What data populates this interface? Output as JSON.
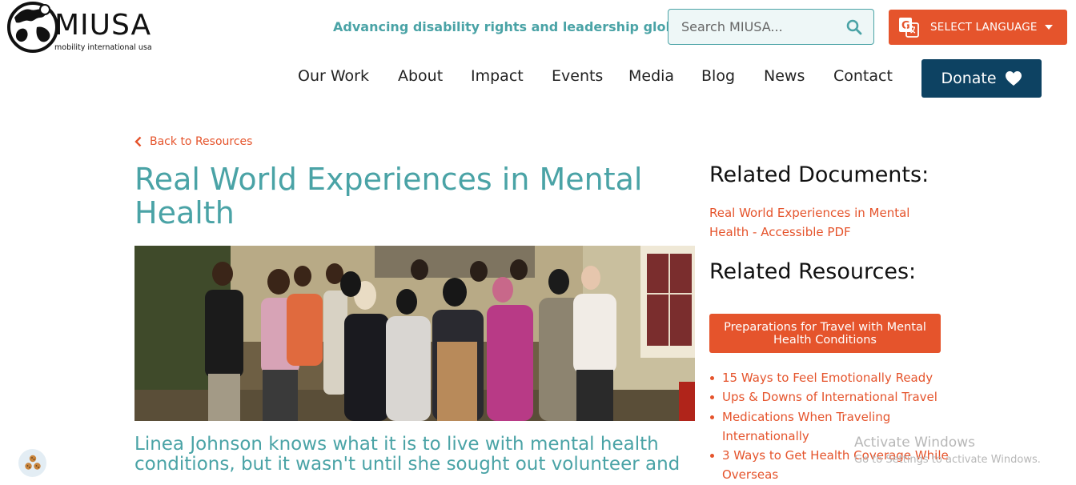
{
  "brand": {
    "name": "MIUSA",
    "subtitle": "mobility international usa",
    "tagline": "Advancing disability rights and leadership globally®"
  },
  "search": {
    "placeholder": "Search MIUSA...",
    "value": ""
  },
  "language": {
    "label": "SELECT LANGUAGE"
  },
  "nav": {
    "items": [
      "Our Work",
      "About",
      "Impact",
      "Events",
      "Media",
      "Blog",
      "News",
      "Contact"
    ]
  },
  "donate": {
    "label": "Donate"
  },
  "main": {
    "back_label": "Back to Resources",
    "title": "Real World Experiences in Mental Health",
    "intro": "Linea Johnson knows what it is to live with mental health conditions, but it wasn't until she sought out volunteer and"
  },
  "sidebar": {
    "related_documents_heading": "Related Documents:",
    "document_link": "Real World Experiences in Mental Health - Accessible PDF",
    "related_resources_heading": "Related Resources:",
    "featured_resource": "Preparations for Travel with Mental Health Conditions",
    "resources": [
      "15 Ways to Feel Emotionally Ready",
      "Ups & Downs of International Travel",
      "Medications When Traveling Internationally",
      "3 Ways to Get Health Coverage While Overseas"
    ]
  },
  "overlay": {
    "activate_title": "Activate Windows",
    "activate_sub": "Go to Settings to activate Windows."
  },
  "colors": {
    "teal": "#4aa3a6",
    "orange": "#e5542c",
    "navy": "#0d4262"
  },
  "icons": [
    "globe-logo-icon",
    "search-icon",
    "translate-icon",
    "chevron-down-icon",
    "heart-icon",
    "chevron-left-icon",
    "cookie-icon"
  ]
}
